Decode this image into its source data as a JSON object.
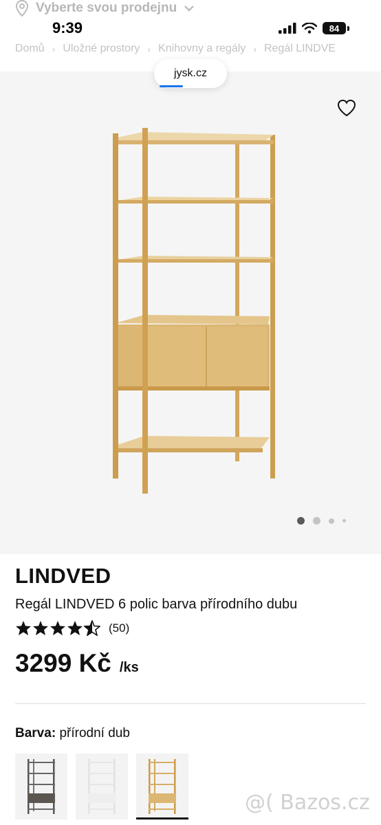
{
  "status_bar": {
    "time": "9:39",
    "battery": "84"
  },
  "store_selector": {
    "label": "Vyberte svou prodejnu"
  },
  "breadcrumb": [
    "Domů",
    "Úložné prostory",
    "Knihovny a regály",
    "Regál LINDVE"
  ],
  "browser": {
    "url": "jysk.cz"
  },
  "gallery": {
    "slides": 4,
    "active": 0
  },
  "product": {
    "brand": "LINDVED",
    "name": "Regál LINDVED 6 polic barva přírodního dubu",
    "rating": 4.5,
    "reviews": "(50)",
    "price": "3299 Kč",
    "unit": "/ks"
  },
  "color": {
    "label": "Barva:",
    "value": "přírodní dub",
    "options": [
      "dark",
      "white",
      "natural-oak"
    ],
    "selected": 2
  },
  "watermark": "@( Bazos.cz",
  "colors": {
    "oak": "#d6ad66",
    "frame": "#c99a47",
    "gallery_bg": "#f5f5f5"
  }
}
